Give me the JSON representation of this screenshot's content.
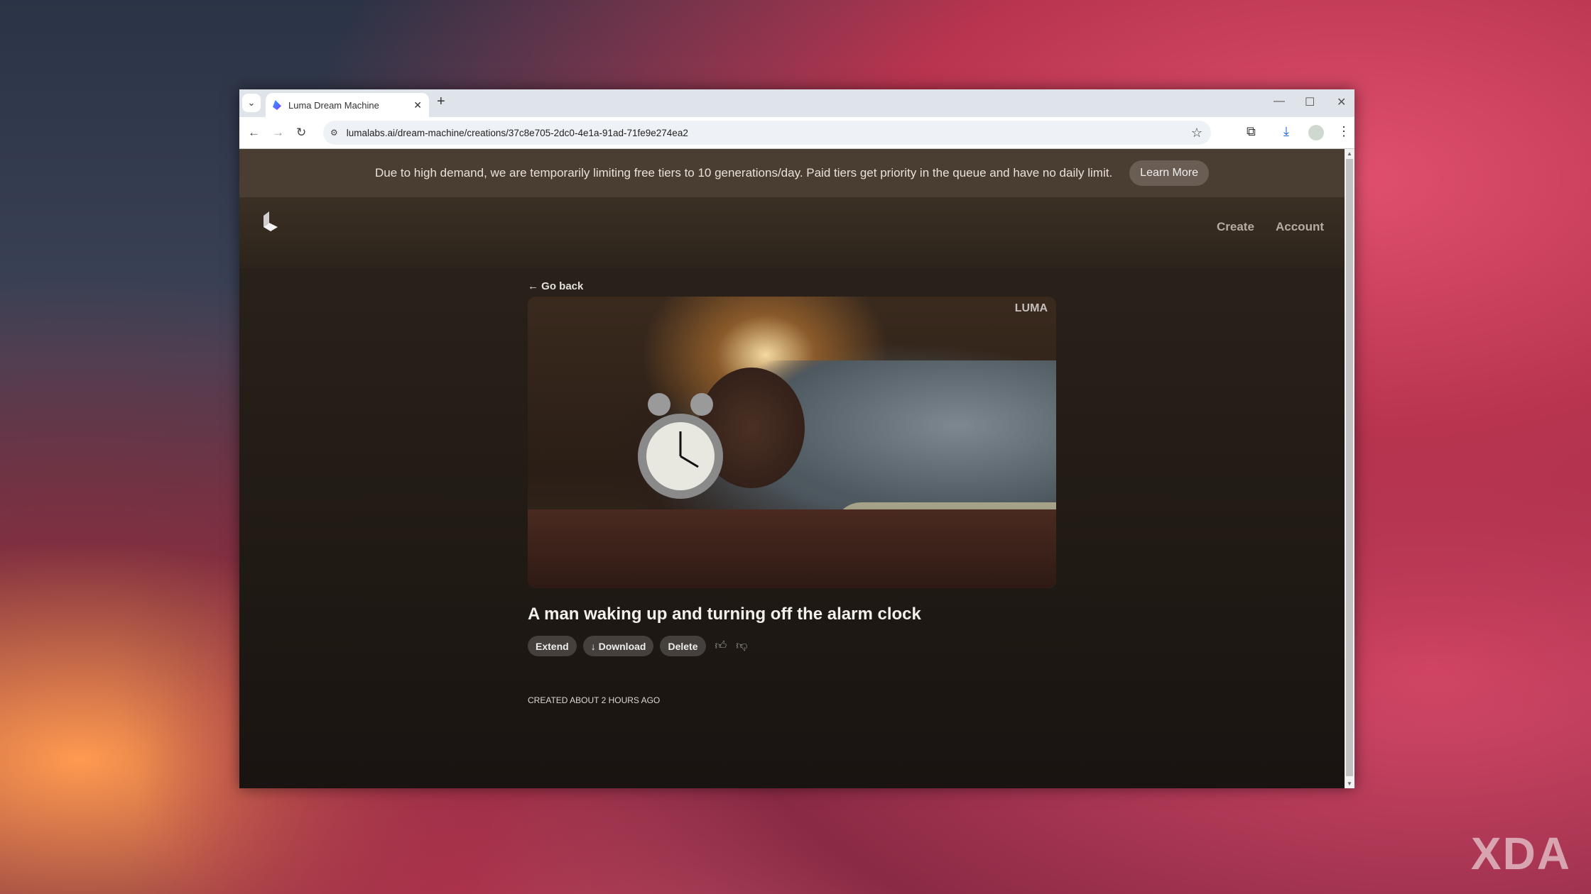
{
  "browser": {
    "tab_title": "Luma Dream Machine",
    "url": "lumalabs.ai/dream-machine/creations/37c8e705-2dc0-4e1a-91ad-71fe9e274ea2"
  },
  "banner": {
    "text": "Due to high demand, we are temporarily limiting free tiers to 10 generations/day. Paid tiers get priority in the queue and have no daily limit.",
    "button": "Learn More"
  },
  "nav": {
    "create": "Create",
    "account": "Account"
  },
  "page": {
    "go_back": "Go back",
    "video_watermark": "LUMA",
    "title": "A man waking up and turning off the alarm clock",
    "created": "CREATED ABOUT 2 HOURS AGO"
  },
  "actions": {
    "extend": "Extend",
    "download": "Download",
    "delete": "Delete"
  },
  "watermark": "XDA",
  "colors": {
    "banner_bg": "#4a3e33",
    "page_bg": "#231c16",
    "button_bg": "#45403b"
  }
}
